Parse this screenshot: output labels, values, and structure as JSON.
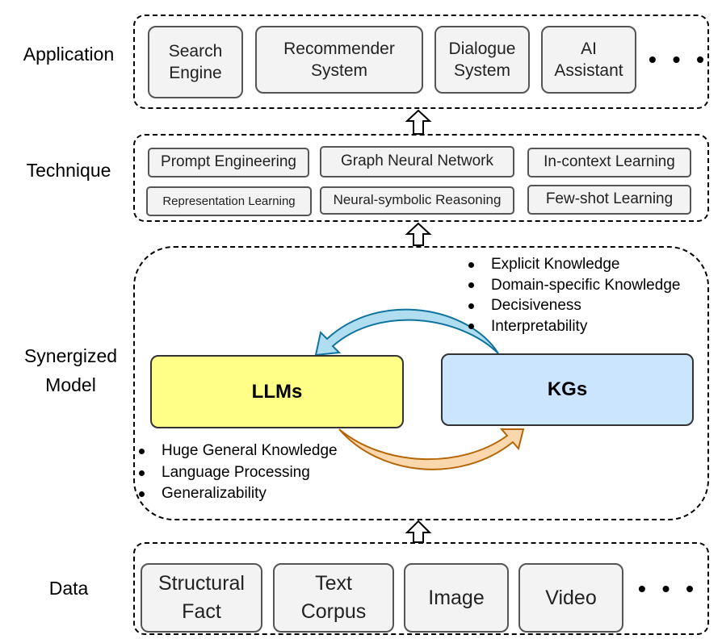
{
  "layers": {
    "application": {
      "label": "Application",
      "items": [
        "Search\nEngine",
        "Recommender\nSystem",
        "Dialogue\nSystem",
        "AI\nAssistant"
      ],
      "more": "• • •"
    },
    "technique": {
      "label": "Technique",
      "items": [
        "Prompt Engineering",
        "Graph Neural Network",
        "In-context Learning",
        "Representation Learning",
        "Neural-symbolic Reasoning",
        "Few-shot Learning"
      ]
    },
    "synergized": {
      "label": "Synergized\nModel",
      "llm": {
        "name": "LLMs",
        "color": "#ffff88",
        "features": [
          "Huge General Knowledge",
          "Language Processing",
          "Generalizability"
        ]
      },
      "kg": {
        "name": "KGs",
        "color": "#cce5ff",
        "features": [
          "Explicit Knowledge",
          "Domain-specific Knowledge",
          "Decisiveness",
          "Interpretability"
        ]
      },
      "arrow_colors": {
        "kg_to_llm": "#b1ddf0",
        "kg_to_llm_stroke": "#10739e",
        "llm_to_kg": "#fad7ac",
        "llm_to_kg_stroke": "#b46504"
      }
    },
    "data": {
      "label": "Data",
      "items": [
        "Structural\nFact",
        "Text\nCorpus",
        "Image",
        "Video"
      ],
      "more": "• • •"
    }
  }
}
